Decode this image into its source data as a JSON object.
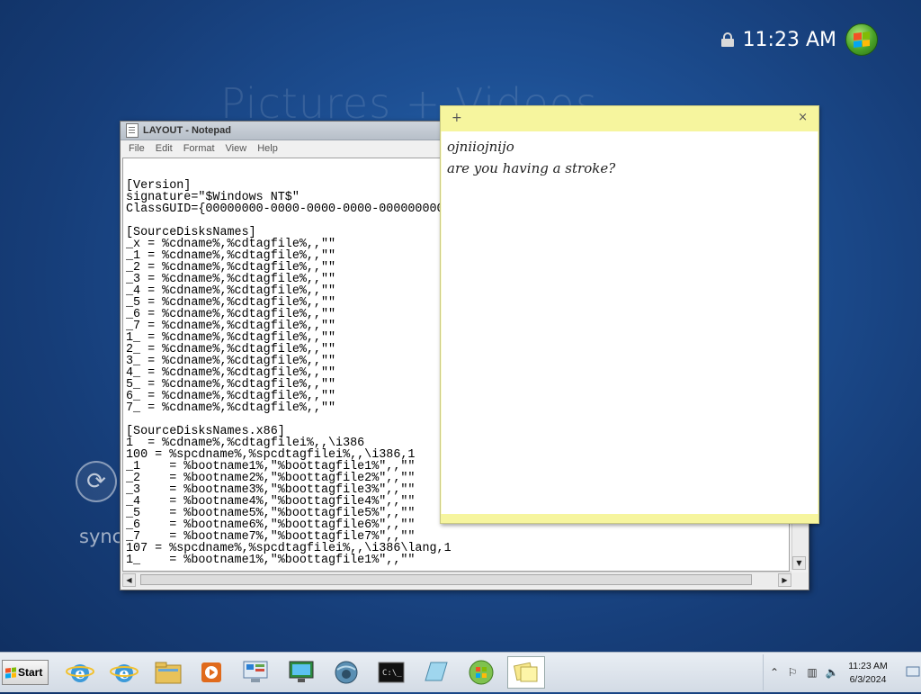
{
  "desktop": {
    "background_text": "Pictures + Videos",
    "clock_time": "11:23 AM",
    "sync_label": "sync"
  },
  "notepad": {
    "title": "LAYOUT - Notepad",
    "menu": [
      "File",
      "Edit",
      "Format",
      "View",
      "Help"
    ],
    "lines": [
      "[Version]",
      "signature=\"$Windows NT$\"",
      "ClassGUID={00000000-0000-0000-0000-000000000000}",
      "",
      "[SourceDisksNames]",
      "_x = %cdname%,%cdtagfile%,,\"\"",
      "_1 = %cdname%,%cdtagfile%,,\"\"",
      "_2 = %cdname%,%cdtagfile%,,\"\"",
      "_3 = %cdname%,%cdtagfile%,,\"\"",
      "_4 = %cdname%,%cdtagfile%,,\"\"",
      "_5 = %cdname%,%cdtagfile%,,\"\"",
      "_6 = %cdname%,%cdtagfile%,,\"\"",
      "_7 = %cdname%,%cdtagfile%,,\"\"",
      "1_ = %cdname%,%cdtagfile%,,\"\"",
      "2_ = %cdname%,%cdtagfile%,,\"\"",
      "3_ = %cdname%,%cdtagfile%,,\"\"",
      "4_ = %cdname%,%cdtagfile%,,\"\"",
      "5_ = %cdname%,%cdtagfile%,,\"\"",
      "6_ = %cdname%,%cdtagfile%,,\"\"",
      "7_ = %cdname%,%cdtagfile%,,\"\"",
      "",
      "[SourceDisksNames.x86]",
      "1  = %cdname%,%cdtagfilei%,,\\i386",
      "100 = %spcdname%,%spcdtagfilei%,,\\i386,1",
      "_1    = %bootname1%,\"%boottagfile1%\",,\"\"",
      "_2    = %bootname2%,\"%boottagfile2%\",,\"\"",
      "_3    = %bootname3%,\"%boottagfile3%\",,\"\"",
      "_4    = %bootname4%,\"%boottagfile4%\",,\"\"",
      "_5    = %bootname5%,\"%boottagfile5%\",,\"\"",
      "_6    = %bootname6%,\"%boottagfile6%\",,\"\"",
      "_7    = %bootname7%,\"%boottagfile7%\",,\"\"",
      "107 = %spcdname%,%spcdtagfilei%,,\\i386\\lang,1",
      "1_    = %bootname1%,\"%boottagfile1%\",,\"\""
    ]
  },
  "sticky_note": {
    "plus_icon": "+",
    "close_icon": "×",
    "lines": [
      "ojniiojnijo",
      "are you having a stroke?"
    ]
  },
  "taskbar": {
    "start_label": "Start",
    "apps": [
      "internet-explorer-icon",
      "internet-explorer-icon",
      "file-explorer-icon",
      "media-player-icon",
      "control-panel-icon",
      "remote-desktop-icon",
      "network-globe-icon",
      "command-prompt-icon",
      "glass-panel-icon",
      "windows-update-icon",
      "sticky-notes-icon"
    ],
    "active_app": "sticky-notes-icon",
    "clock_time": "11:23 AM",
    "clock_date": "6/3/2024"
  },
  "colors": {
    "desktop_blue": "#1d4f93",
    "sticky_yellow": "#fdfdc9",
    "taskbar": "#dde4ec"
  }
}
